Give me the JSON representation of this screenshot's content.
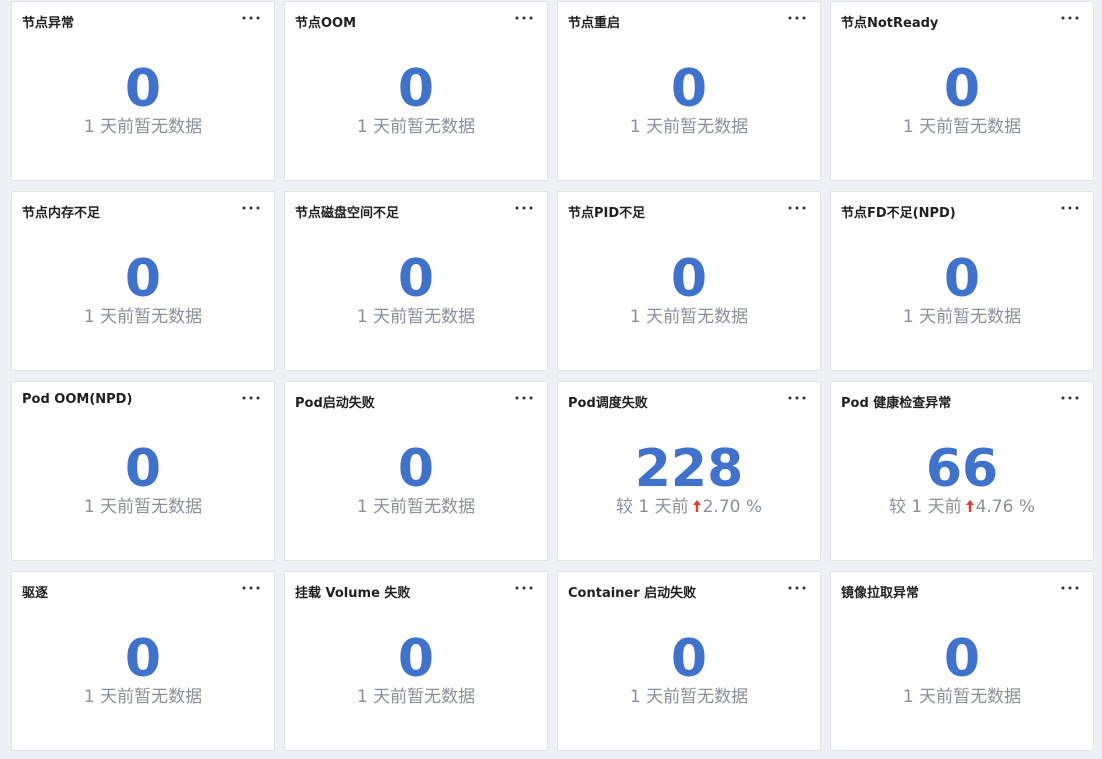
{
  "colors": {
    "value": "#3f72cc",
    "subtext": "#8a8f99",
    "trend_up": "#e83b2f",
    "background": "#eef0f5"
  },
  "cards": [
    {
      "title": "节点异常",
      "value": "0",
      "subtext": "1 天前暂无数据"
    },
    {
      "title": "节点OOM",
      "value": "0",
      "subtext": "1 天前暂无数据"
    },
    {
      "title": "节点重启",
      "value": "0",
      "subtext": "1 天前暂无数据"
    },
    {
      "title": "节点NotReady",
      "value": "0",
      "subtext": "1 天前暂无数据"
    },
    {
      "title": "节点内存不足",
      "value": "0",
      "subtext": "1 天前暂无数据"
    },
    {
      "title": "节点磁盘空间不足",
      "value": "0",
      "subtext": "1 天前暂无数据"
    },
    {
      "title": "节点PID不足",
      "value": "0",
      "subtext": "1 天前暂无数据"
    },
    {
      "title": "节点FD不足(NPD)",
      "value": "0",
      "subtext": "1 天前暂无数据"
    },
    {
      "title": "Pod OOM(NPD)",
      "value": "0",
      "subtext": "1 天前暂无数据"
    },
    {
      "title": "Pod启动失败",
      "value": "0",
      "subtext": "1 天前暂无数据"
    },
    {
      "title": "Pod调度失败",
      "value": "228",
      "compare_prefix": "较 1 天前",
      "trend": "up",
      "change": "2.70 %"
    },
    {
      "title": "Pod 健康检查异常",
      "value": "66",
      "compare_prefix": "较 1 天前",
      "trend": "up",
      "change": "4.76 %"
    },
    {
      "title": "驱逐",
      "value": "0",
      "subtext": "1 天前暂无数据"
    },
    {
      "title": "挂载 Volume 失败",
      "value": "0",
      "subtext": "1 天前暂无数据"
    },
    {
      "title": "Container 启动失败",
      "value": "0",
      "subtext": "1 天前暂无数据"
    },
    {
      "title": "镜像拉取异常",
      "value": "0",
      "subtext": "1 天前暂无数据"
    }
  ],
  "icons": {
    "more": "more-dots-icon",
    "trend_up": "arrow-up-icon"
  }
}
